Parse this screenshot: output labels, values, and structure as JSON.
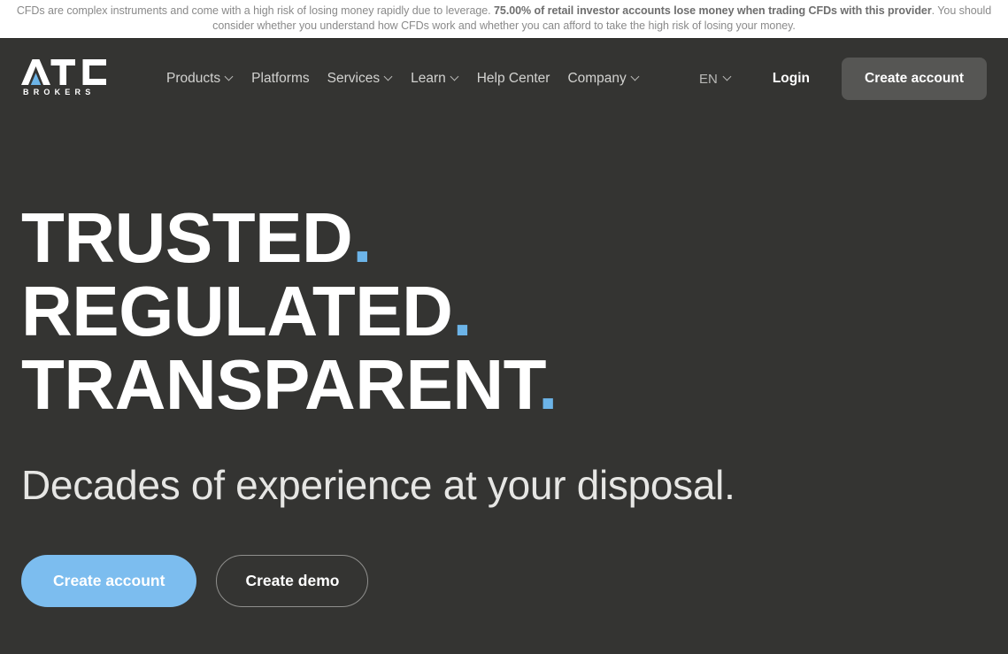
{
  "disclaimer": {
    "part1": "CFDs are complex instruments and come with a high risk of losing money rapidly due to leverage. ",
    "bold": "75.00% of retail investor accounts lose money when trading CFDs with this provider",
    "part2": ". You should consider whether you understand how CFDs work and whether you can afford to take the high risk of losing your money."
  },
  "header": {
    "logo": {
      "mark": "ATC",
      "sub": "BROKERS"
    },
    "nav": [
      {
        "label": "Products",
        "caret": true
      },
      {
        "label": "Platforms",
        "caret": false
      },
      {
        "label": "Services",
        "caret": true
      },
      {
        "label": "Learn",
        "caret": true
      },
      {
        "label": "Help Center",
        "caret": false
      },
      {
        "label": "Company",
        "caret": true
      }
    ],
    "language": "EN",
    "login_label": "Login",
    "create_account_label": "Create account"
  },
  "hero": {
    "headline": [
      {
        "word": "TRUSTED",
        "dot": "."
      },
      {
        "word": "REGULATED",
        "dot": "."
      },
      {
        "word": "TRANSPARENT",
        "dot": "."
      }
    ],
    "subhead": "Decades of experience at your disposal.",
    "cta_primary": "Create account",
    "cta_secondary": "Create demo"
  },
  "colors": {
    "background": "#343432",
    "accent_blue": "#6cb4e8",
    "primary_button": "#7cbdef",
    "header_button": "#565654",
    "disclaimer_text": "#8a8a8a"
  }
}
